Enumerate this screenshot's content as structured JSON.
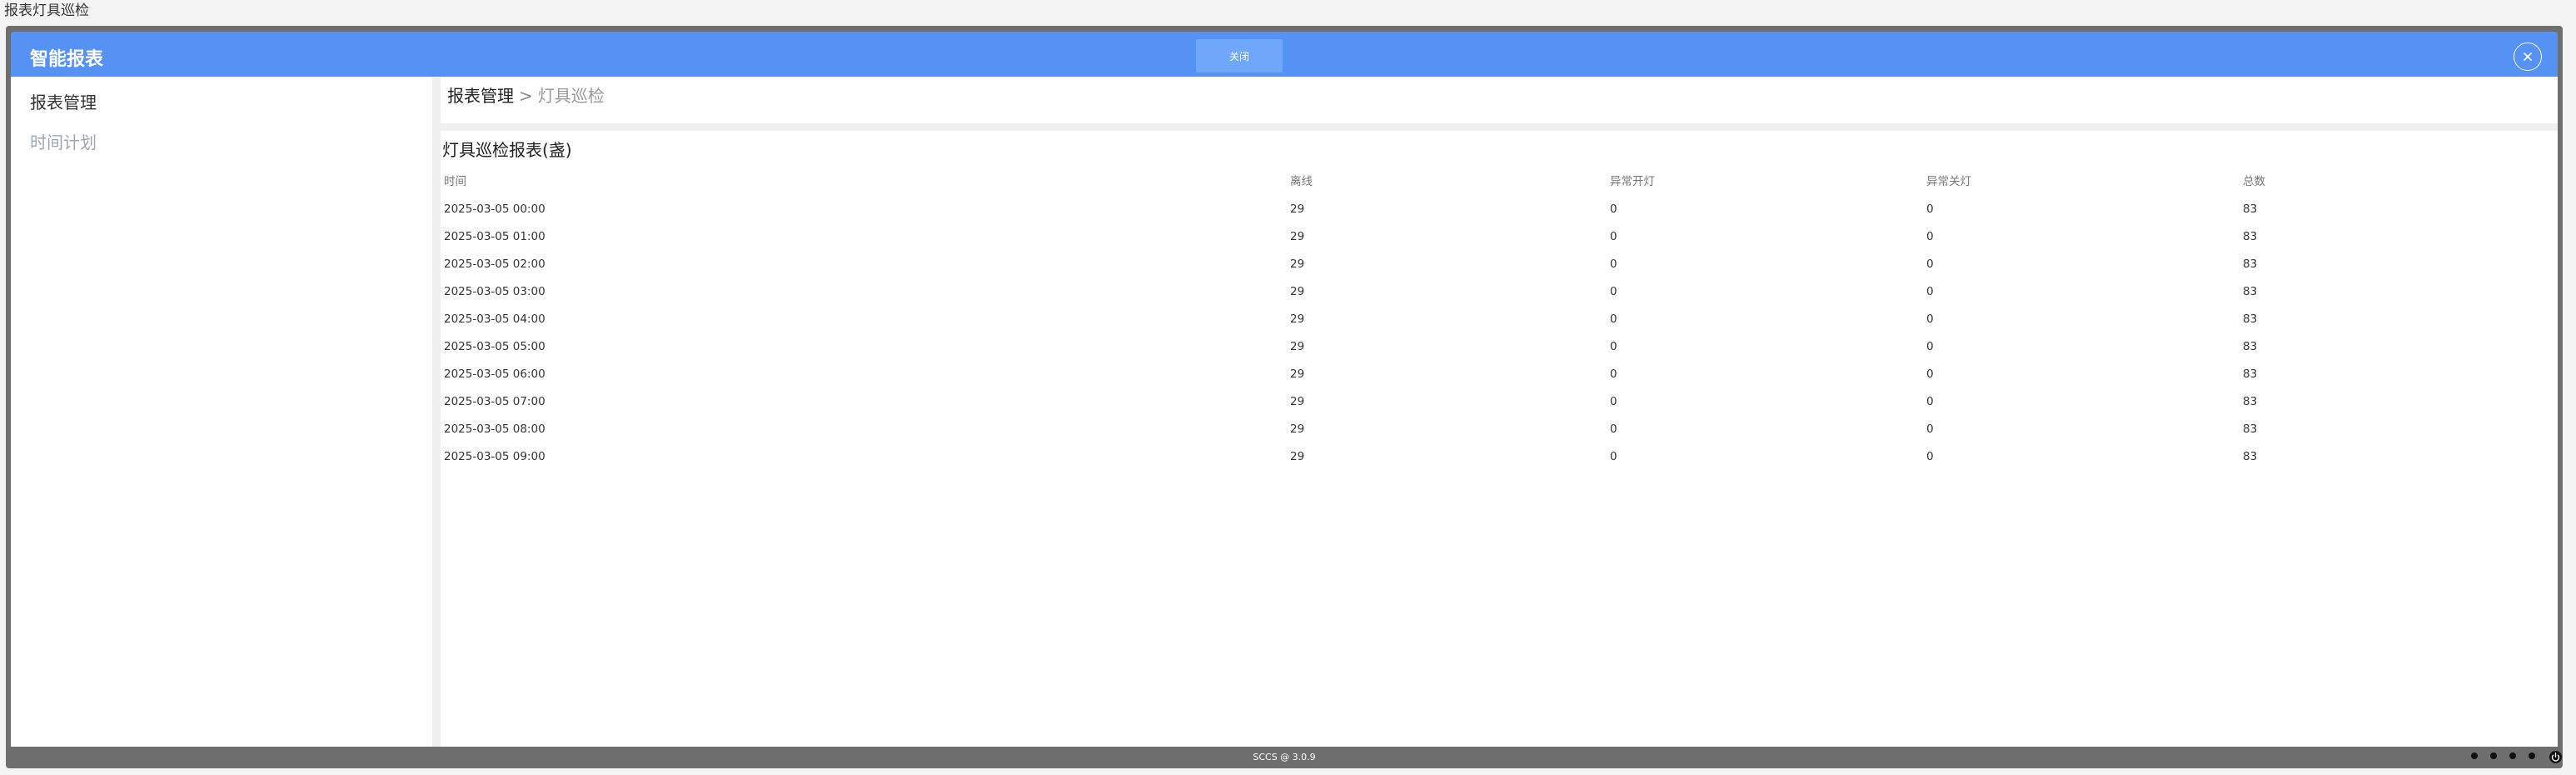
{
  "page": {
    "title": "报表灯具巡检"
  },
  "header": {
    "title": "智能报表",
    "close_label": "关闭"
  },
  "sidebar": {
    "items": [
      {
        "label": "报表管理",
        "active": true
      },
      {
        "label": "时间计划",
        "active": false
      }
    ]
  },
  "breadcrumb": {
    "root": "报表管理",
    "separator": ">",
    "current": "灯具巡检"
  },
  "report": {
    "title": "灯具巡检报表(盏)",
    "columns": [
      "时间",
      "离线",
      "异常开灯",
      "异常关灯",
      "总数"
    ],
    "rows": [
      [
        "2025-03-05 00:00",
        "29",
        "0",
        "0",
        "83"
      ],
      [
        "2025-03-05 01:00",
        "29",
        "0",
        "0",
        "83"
      ],
      [
        "2025-03-05 02:00",
        "29",
        "0",
        "0",
        "83"
      ],
      [
        "2025-03-05 03:00",
        "29",
        "0",
        "0",
        "83"
      ],
      [
        "2025-03-05 04:00",
        "29",
        "0",
        "0",
        "83"
      ],
      [
        "2025-03-05 05:00",
        "29",
        "0",
        "0",
        "83"
      ],
      [
        "2025-03-05 06:00",
        "29",
        "0",
        "0",
        "83"
      ],
      [
        "2025-03-05 07:00",
        "29",
        "0",
        "0",
        "83"
      ],
      [
        "2025-03-05 08:00",
        "29",
        "0",
        "0",
        "83"
      ],
      [
        "2025-03-05 09:00",
        "29",
        "0",
        "0",
        "83"
      ]
    ]
  },
  "footer": {
    "version": "SCCS @ 3.0.9"
  },
  "icons": {
    "close": "close-icon",
    "dots": "pagination-dot-icon",
    "corner": "power-icon"
  },
  "colors": {
    "header": "#5592f4",
    "close_button": "#6fa8fb",
    "frame": "#6e6e6e"
  }
}
